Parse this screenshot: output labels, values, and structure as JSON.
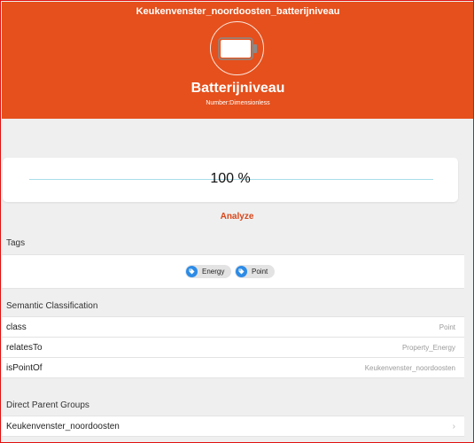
{
  "header": {
    "item_title": "Keukenvenster_noordoosten_batterijniveau",
    "point_name": "Batterijniveau",
    "point_type": "Number:Dimensionless",
    "icon": "battery-icon",
    "background_color": "#e5501c"
  },
  "state": {
    "value_text": "100 %",
    "battery_level_fraction": 1.0
  },
  "analyze_label": "Analyze",
  "tags": {
    "heading": "Tags",
    "items": [
      {
        "label": "Energy",
        "icon": "tag-icon"
      },
      {
        "label": "Point",
        "icon": "tag-icon"
      }
    ]
  },
  "semantic": {
    "heading": "Semantic Classification",
    "rows": [
      {
        "key": "class",
        "value": "Point"
      },
      {
        "key": "relatesTo",
        "value": "Property_Energy"
      },
      {
        "key": "isPointOf",
        "value": "Keukenvenster_noordoosten"
      }
    ]
  },
  "parents": {
    "heading": "Direct Parent Groups",
    "items": [
      {
        "label": "Keukenvenster_noordoosten"
      }
    ]
  },
  "colors": {
    "accent": "#e5501c",
    "analyze": "#d8471b",
    "tag_icon": "#2d8be6"
  }
}
